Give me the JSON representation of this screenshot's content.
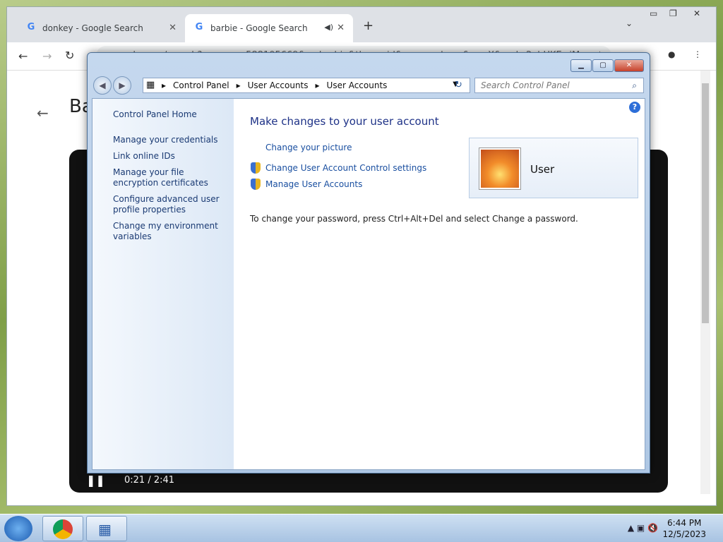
{
  "browser": {
    "tabs": [
      {
        "label": "donkey - Google Search"
      },
      {
        "label": "barbie - Google Search"
      }
    ],
    "new_tab": "+",
    "url": "google.com/search?sca_esv=588105669&q=barbie&tbm=vid&source=lnms&sa=X&ved=2ahUKEwiMs",
    "page_title_partial": "Ba",
    "video": {
      "time": "0:21 / 2:41"
    }
  },
  "window": {
    "breadcrumb": [
      "Control Panel",
      "User Accounts",
      "User Accounts"
    ],
    "search_placeholder": "Search Control Panel",
    "sidebar": [
      {
        "label": "Control Panel Home"
      },
      {
        "label": "Manage your credentials"
      },
      {
        "label": "Link online IDs"
      },
      {
        "label": "Manage your file encryption certificates"
      },
      {
        "label": "Configure advanced user profile properties"
      },
      {
        "label": "Change my environment variables"
      }
    ],
    "heading": "Make changes to your user account",
    "links": {
      "picture": "Change your picture",
      "uac": "Change User Account Control settings",
      "manage": "Manage User Accounts"
    },
    "account_name": "User",
    "info": "To change your password, press Ctrl+Alt+Del and select Change a password."
  },
  "taskbar": {
    "time": "6:44 PM",
    "date": "12/5/2023"
  }
}
